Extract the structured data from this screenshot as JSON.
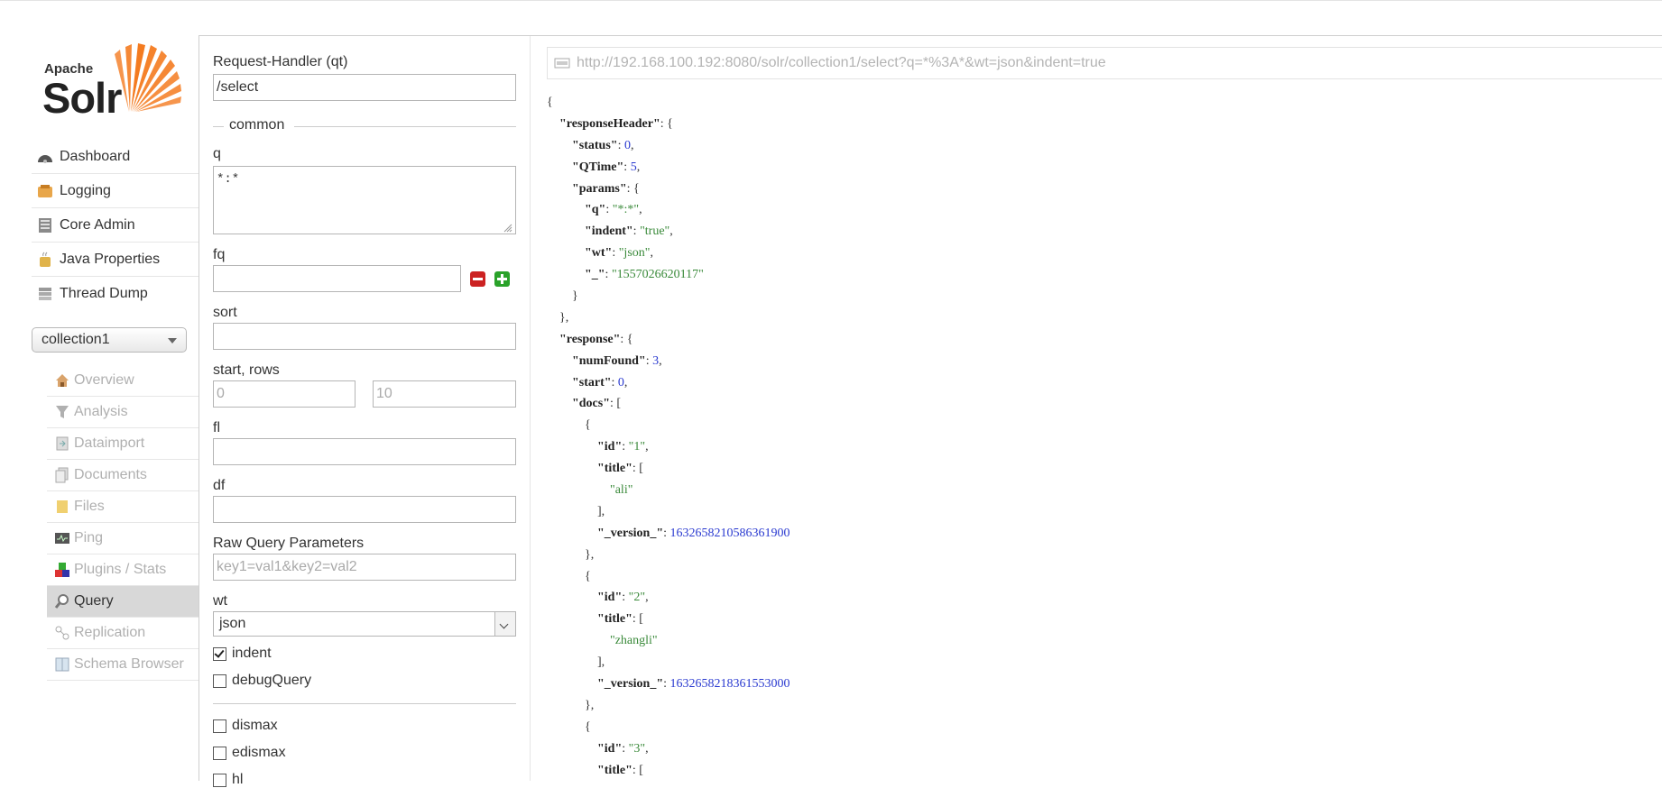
{
  "logo": {
    "top_text": "Apache",
    "main_text": "Solr"
  },
  "nav": {
    "items": [
      {
        "label": "Dashboard",
        "icon": "dashboard-icon"
      },
      {
        "label": "Logging",
        "icon": "logging-icon"
      },
      {
        "label": "Core Admin",
        "icon": "core-admin-icon"
      },
      {
        "label": "Java Properties",
        "icon": "java-properties-icon"
      },
      {
        "label": "Thread Dump",
        "icon": "thread-dump-icon"
      }
    ]
  },
  "core_selector": {
    "value": "collection1"
  },
  "core_menu": {
    "items": [
      {
        "label": "Overview",
        "icon": "overview-icon"
      },
      {
        "label": "Analysis",
        "icon": "analysis-icon"
      },
      {
        "label": "Dataimport",
        "icon": "dataimport-icon"
      },
      {
        "label": "Documents",
        "icon": "documents-icon"
      },
      {
        "label": "Files",
        "icon": "files-icon"
      },
      {
        "label": "Ping",
        "icon": "ping-icon"
      },
      {
        "label": "Plugins / Stats",
        "icon": "plugins-icon"
      },
      {
        "label": "Query",
        "icon": "query-icon",
        "active": true
      },
      {
        "label": "Replication",
        "icon": "replication-icon"
      },
      {
        "label": "Schema Browser",
        "icon": "schema-browser-icon"
      }
    ]
  },
  "form": {
    "qt_label": "Request-Handler (qt)",
    "qt_value": "/select",
    "common_legend": "common",
    "q_label": "q",
    "q_value": "*:*",
    "fq_label": "fq",
    "fq_value": "",
    "sort_label": "sort",
    "sort_value": "",
    "start_rows_label": "start, rows",
    "start_placeholder": "0",
    "rows_placeholder": "10",
    "fl_label": "fl",
    "fl_value": "",
    "df_label": "df",
    "df_value": "",
    "raw_label": "Raw Query Parameters",
    "raw_placeholder": "key1=val1&key2=val2",
    "wt_label": "wt",
    "wt_value": "json",
    "indent_label": "indent",
    "indent_checked": true,
    "debug_label": "debugQuery",
    "debug_checked": false,
    "dismax_label": "dismax",
    "edismax_label": "edismax",
    "hl_label": "hl"
  },
  "result": {
    "url": "http://192.168.100.192:8080/solr/collection1/select?q=*%3A*&wt=json&indent=true",
    "lines": [
      [
        0,
        [
          [
            "p",
            "{"
          ]
        ]
      ],
      [
        1,
        [
          [
            "k",
            "\"responseHeader\""
          ],
          [
            "p",
            ": {"
          ]
        ]
      ],
      [
        2,
        [
          [
            "k",
            "\"status\""
          ],
          [
            "p",
            ": "
          ],
          [
            "n",
            "0"
          ],
          [
            "p",
            ","
          ]
        ]
      ],
      [
        2,
        [
          [
            "k",
            "\"QTime\""
          ],
          [
            "p",
            ": "
          ],
          [
            "n",
            "5"
          ],
          [
            "p",
            ","
          ]
        ]
      ],
      [
        2,
        [
          [
            "k",
            "\"params\""
          ],
          [
            "p",
            ": {"
          ]
        ]
      ],
      [
        3,
        [
          [
            "k",
            "\"q\""
          ],
          [
            "p",
            ": "
          ],
          [
            "s",
            "\"*:*\""
          ],
          [
            "p",
            ","
          ]
        ]
      ],
      [
        3,
        [
          [
            "k",
            "\"indent\""
          ],
          [
            "p",
            ": "
          ],
          [
            "s",
            "\"true\""
          ],
          [
            "p",
            ","
          ]
        ]
      ],
      [
        3,
        [
          [
            "k",
            "\"wt\""
          ],
          [
            "p",
            ": "
          ],
          [
            "s",
            "\"json\""
          ],
          [
            "p",
            ","
          ]
        ]
      ],
      [
        3,
        [
          [
            "k",
            "\"_\""
          ],
          [
            "p",
            ": "
          ],
          [
            "s",
            "\"1557026620117\""
          ]
        ]
      ],
      [
        2,
        [
          [
            "p",
            "}"
          ]
        ]
      ],
      [
        1,
        [
          [
            "p",
            "},"
          ]
        ]
      ],
      [
        1,
        [
          [
            "k",
            "\"response\""
          ],
          [
            "p",
            ": {"
          ]
        ]
      ],
      [
        2,
        [
          [
            "k",
            "\"numFound\""
          ],
          [
            "p",
            ": "
          ],
          [
            "n",
            "3"
          ],
          [
            "p",
            ","
          ]
        ]
      ],
      [
        2,
        [
          [
            "k",
            "\"start\""
          ],
          [
            "p",
            ": "
          ],
          [
            "n",
            "0"
          ],
          [
            "p",
            ","
          ]
        ]
      ],
      [
        2,
        [
          [
            "k",
            "\"docs\""
          ],
          [
            "p",
            ": ["
          ]
        ]
      ],
      [
        3,
        [
          [
            "p",
            "{"
          ]
        ]
      ],
      [
        4,
        [
          [
            "k",
            "\"id\""
          ],
          [
            "p",
            ": "
          ],
          [
            "s",
            "\"1\""
          ],
          [
            "p",
            ","
          ]
        ]
      ],
      [
        4,
        [
          [
            "k",
            "\"title\""
          ],
          [
            "p",
            ": ["
          ]
        ]
      ],
      [
        5,
        [
          [
            "s",
            "\"ali\""
          ]
        ]
      ],
      [
        4,
        [
          [
            "p",
            "],"
          ]
        ]
      ],
      [
        4,
        [
          [
            "k",
            "\"_version_\""
          ],
          [
            "p",
            ": "
          ],
          [
            "n",
            "1632658210586361900"
          ]
        ]
      ],
      [
        3,
        [
          [
            "p",
            "},"
          ]
        ]
      ],
      [
        3,
        [
          [
            "p",
            "{"
          ]
        ]
      ],
      [
        4,
        [
          [
            "k",
            "\"id\""
          ],
          [
            "p",
            ": "
          ],
          [
            "s",
            "\"2\""
          ],
          [
            "p",
            ","
          ]
        ]
      ],
      [
        4,
        [
          [
            "k",
            "\"title\""
          ],
          [
            "p",
            ": ["
          ]
        ]
      ],
      [
        5,
        [
          [
            "s",
            "\"zhangli\""
          ]
        ]
      ],
      [
        4,
        [
          [
            "p",
            "],"
          ]
        ]
      ],
      [
        4,
        [
          [
            "k",
            "\"_version_\""
          ],
          [
            "p",
            ": "
          ],
          [
            "n",
            "1632658218361553000"
          ]
        ]
      ],
      [
        3,
        [
          [
            "p",
            "},"
          ]
        ]
      ],
      [
        3,
        [
          [
            "p",
            "{"
          ]
        ]
      ],
      [
        4,
        [
          [
            "k",
            "\"id\""
          ],
          [
            "p",
            ": "
          ],
          [
            "s",
            "\"3\""
          ],
          [
            "p",
            ","
          ]
        ]
      ],
      [
        4,
        [
          [
            "k",
            "\"title\""
          ],
          [
            "p",
            ": ["
          ]
        ]
      ]
    ]
  },
  "colors": {
    "string": "#3a8a3a",
    "number": "#2a3ad0",
    "logo_orange": "#f47b20",
    "remove_red": "#cc2222",
    "add_green": "#2aa22a"
  }
}
